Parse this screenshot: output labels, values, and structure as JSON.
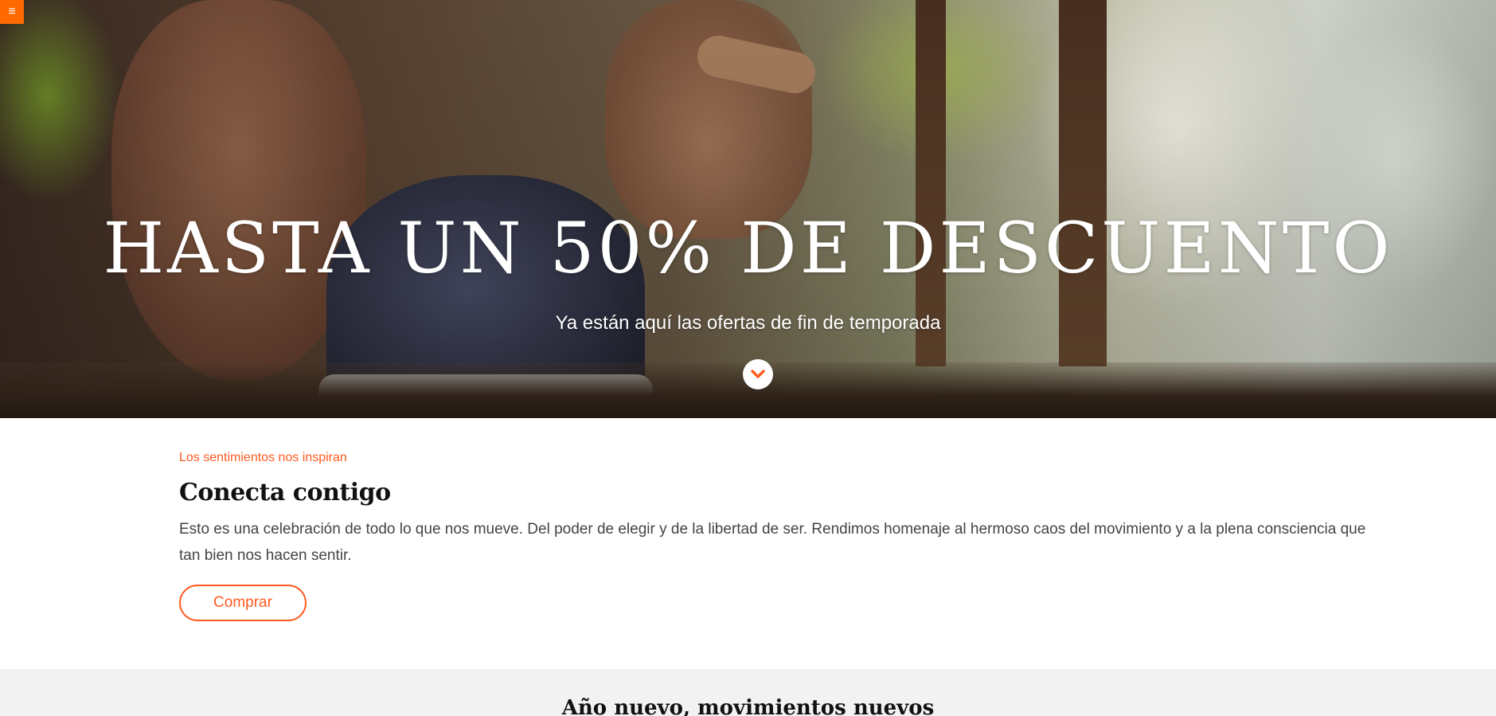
{
  "menu": {
    "icon": "menu-icon",
    "glyph": "≡"
  },
  "hero": {
    "title": "HASTA UN 50% DE DESCUENTO",
    "subtitle": "Ya están aquí las ofertas de fin de temporada",
    "scroll_icon": "chevron-down-icon"
  },
  "intro": {
    "eyebrow": "Los sentimientos nos inspiran",
    "title": "Conecta contigo",
    "body": "Esto es una celebración de todo lo que nos mueve. Del poder de elegir y de la libertad de ser. Rendimos homenaje al hermoso caos del movimiento y a la plena consciencia que tan bien nos hacen sentir.",
    "button_label": "Comprar"
  },
  "next_section": {
    "title": "Año nuevo, movimientos nuevos"
  },
  "colors": {
    "accent": "#ff5a1f",
    "menu_bg": "#ff6a00",
    "section_bg": "#f2f2f2"
  }
}
